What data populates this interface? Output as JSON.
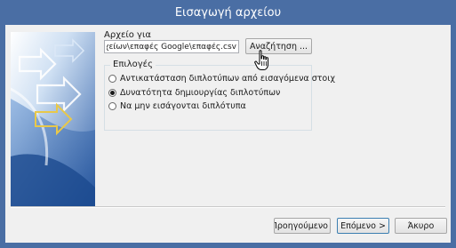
{
  "window": {
    "title": "Εισαγωγή αρχείου",
    "titlebar_color": "#4a6ea4",
    "client_color": "#f0f0f0"
  },
  "file": {
    "label": "Αρχείο για",
    "value": "αρχείων\\επαφές Google\\επαφές.csv",
    "browse_label": "Αναζήτηση ..."
  },
  "options": {
    "legend": "Επιλογές",
    "items": [
      {
        "label": "Αντικατάσταση διπλοτύπων από εισαγόμενα στοιχ",
        "selected": false
      },
      {
        "label": "Δυνατότητα δημιουργίας διπλοτύπων",
        "selected": true
      },
      {
        "label": "Να μην εισάγονται διπλότυπα",
        "selected": false
      }
    ]
  },
  "footer": {
    "prev_label": "< Προηγούμενο",
    "next_label": "Επόμενο >",
    "cancel_label": "Άκυρο"
  },
  "icons": {
    "cursor": "hand-pointer-icon",
    "wizard_art": "import-wizard-arrows-icon"
  }
}
